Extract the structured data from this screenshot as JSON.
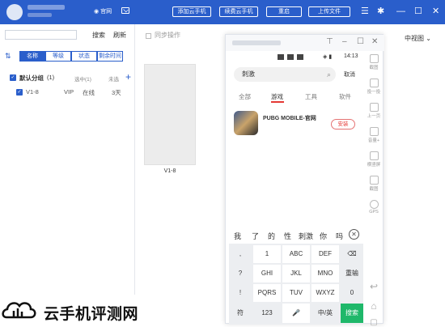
{
  "header": {
    "official_label": "官网",
    "buttons": [
      "添加云手机",
      "续费云手机",
      "重启",
      "上传文件"
    ],
    "accent": "#2a5ecb"
  },
  "left": {
    "search_label": "搜索",
    "refresh_label": "刷新",
    "tabs": [
      "名称",
      "等级",
      "状态",
      "剩余时间"
    ],
    "group": {
      "name": "默认分组",
      "count": "(1)",
      "selected": "选中(1)",
      "unselected": "未选"
    },
    "device": {
      "name": "V1-8",
      "level": "VIP",
      "status": "在线",
      "days": "3天"
    }
  },
  "middle": {
    "sync_label": "同步操作",
    "thumb_label": "V1-8"
  },
  "phone": {
    "time": "14:13",
    "search_value": "刺激",
    "cancel_label": "取消",
    "tabs": [
      "全部",
      "游戏",
      "工具",
      "软件"
    ],
    "app_name": "PUBG MOBILE-官网",
    "install_label": "安装",
    "candidates": [
      "我",
      "了",
      "的",
      "性",
      "刺激",
      "你",
      "吗"
    ],
    "keyboard": {
      "row1": [
        ",",
        "1",
        "ABC",
        "DEF",
        "⌫"
      ],
      "row2": [
        "?",
        "GHI",
        "JKL",
        "MNO",
        "重输"
      ],
      "row3": [
        "!",
        "PQRS",
        "TUV",
        "WXYZ",
        "0"
      ],
      "row4": [
        "符",
        "123",
        "🎤",
        "中/英",
        "搜索"
      ]
    },
    "tools": [
      "截图",
      "投一投",
      "上一页",
      "音量+",
      "横竖屏",
      "截图",
      "GPS"
    ]
  },
  "right": {
    "view_label": "中视图"
  },
  "watermark": {
    "text": "云手机评测网"
  }
}
